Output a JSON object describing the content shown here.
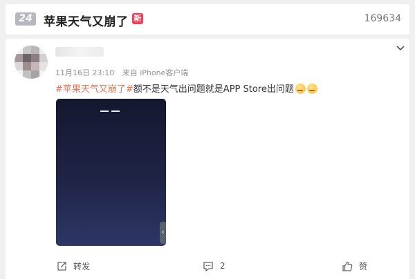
{
  "trending": {
    "rank": "24",
    "topic": "苹果天气又崩了",
    "new_badge": "新",
    "heat": "169634"
  },
  "post": {
    "date": "11月16日 23:10",
    "source": "来自 iPhone客户端",
    "hashtag": "#苹果天气又崩了#",
    "body": "额不是天气出问题就是APP Store出问题",
    "emoji_icon": "crying-face-icon"
  },
  "actions": {
    "repost_label": "转发",
    "comment_count": "2",
    "like_label": "赞"
  },
  "colors": {
    "hashtag": "#eb7350",
    "new_badge": "#ff3852",
    "rank_badge": "#b7b7bf"
  }
}
